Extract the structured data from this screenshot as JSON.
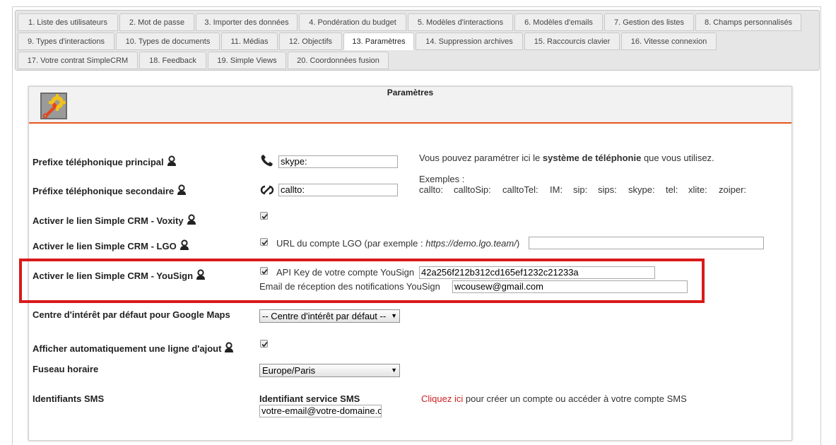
{
  "tabs": [
    {
      "label": "1. Liste des utilisateurs"
    },
    {
      "label": "2. Mot de passe"
    },
    {
      "label": "3. Importer des données"
    },
    {
      "label": "4. Pondération du budget"
    },
    {
      "label": "5. Modèles d'interactions"
    },
    {
      "label": "6. Modèles d'emails"
    },
    {
      "label": "7. Gestion des listes"
    },
    {
      "label": "8. Champs personnalisés"
    },
    {
      "label": "9. Types d'interactions"
    },
    {
      "label": "10. Types de documents"
    },
    {
      "label": "11. Médias"
    },
    {
      "label": "12. Objectifs"
    },
    {
      "label": "13. Paramètres"
    },
    {
      "label": "14. Suppression archives"
    },
    {
      "label": "15. Raccourcis clavier"
    },
    {
      "label": "16. Vitesse connexion"
    },
    {
      "label": "17. Votre contrat SimpleCRM"
    },
    {
      "label": "18. Feedback"
    },
    {
      "label": "19. Simple Views"
    },
    {
      "label": "20. Coordonnées fusion"
    }
  ],
  "panel": {
    "title": "Paramètres",
    "icon": "params-tools-icon"
  },
  "phone": {
    "main_label": "Prefixe téléphonique principal",
    "main_value": "skype:",
    "secondary_label": "Préfixe téléphonique secondaire",
    "secondary_value": "callto:",
    "help_prefix": "Vous pouvez paramétrer ici le ",
    "help_bold": "système de téléphonie",
    "help_suffix": " que vous utilisez.",
    "examples_title": "Exemples :",
    "examples": [
      "callto:",
      "calltoSip:",
      "calltoTel:",
      "IM:",
      "sip:",
      "sips:",
      "skype:",
      "tel:",
      "xlite:",
      "zoiper:"
    ]
  },
  "voxity": {
    "label": "Activer le lien Simple CRM - Voxity",
    "checked": true
  },
  "lgo": {
    "label": "Activer le lien Simple CRM - LGO",
    "checked": true,
    "url_label_prefix": "URL du compte LGO (par exemple : ",
    "url_label_example": "https://demo.lgo.team/",
    "url_label_suffix": ")",
    "url_value": ""
  },
  "yousign": {
    "label": "Activer le lien Simple CRM - YouSign",
    "checked": true,
    "api_label": "API Key de votre compte YouSign",
    "api_value": "42a256f212b312cd165ef1232c21233a",
    "email_label": "Email de réception des notifications YouSign",
    "email_value": "wcousew@gmail.com"
  },
  "maps": {
    "label": "Centre d'intérêt par défaut pour Google Maps",
    "selected": "-- Centre d'intérêt par défaut --"
  },
  "autoline": {
    "label": "Afficher automatiquement une ligne d'ajout",
    "checked": true
  },
  "timezone": {
    "label": "Fuseau horaire",
    "selected": "Europe/Paris"
  },
  "sms": {
    "label": "Identifiants SMS",
    "service_label": "Identifiant service SMS",
    "service_value": "votre-email@votre-domaine.com",
    "link_text": "Cliquez ici",
    "link_suffix": "pour créer un compte ou accéder à votre compte SMS"
  },
  "colors": {
    "accent": "#e8541e",
    "highlight": "#d91a1a",
    "link": "#cc2222"
  }
}
